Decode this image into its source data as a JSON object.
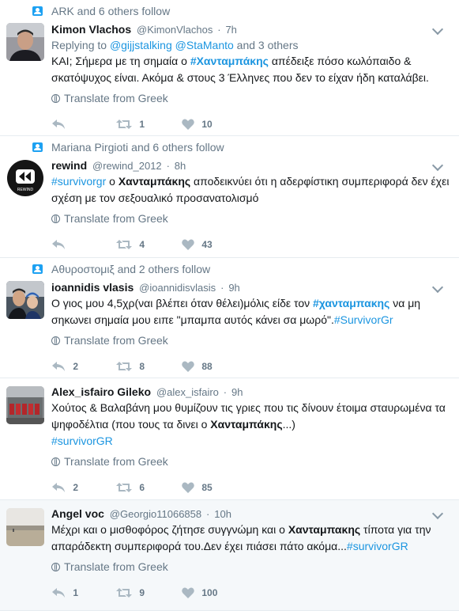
{
  "tweets": [
    {
      "social_context": "ARK and 6 others follow",
      "name": "Kimon Vlachos",
      "handle": "@KimonVlachos",
      "separator": "·",
      "time": "7h",
      "replying_prefix": "Replying to",
      "replying_user1": "@gijjstalking",
      "replying_user2": "@StaManto",
      "replying_suffix": "and 3 others",
      "text_1": "ΚΑΙ; Σήμερα με τη σημαία ο ",
      "hashtag_1": "#Χανταμπάκης",
      "text_2": " απέδειξε πόσο κωλόπαιδο & σκατόψυχος είναι. Ακόμα & στους 3 Έλληνες που δεν το είχαν ήδη καταλάβει.",
      "translate": "Translate from Greek",
      "reply_count": "",
      "retweet_count": "1",
      "like_count": "10"
    },
    {
      "social_context": "Mariana Pirgioti and 6 others follow",
      "name": "rewind",
      "handle": "@rewind_2012",
      "separator": "·",
      "time": "8h",
      "hashtag_1": "#survivorgr",
      "text_1": " ο ",
      "bold_1": "Χανταμπάκης",
      "text_2": " αποδεικνύει ότι η αδερφίστικη συμπεριφορά δεν έχει σχέση με τον σεξουαλικό προσανατολισμό",
      "translate": "Translate from Greek",
      "reply_count": "",
      "retweet_count": "4",
      "like_count": "43"
    },
    {
      "social_context": "Αθυροστομιξ and 2 others follow",
      "name": "ioannidis vlasis",
      "handle": "@ioannidisvlasis",
      "separator": "·",
      "time": "9h",
      "text_1": "Ο γιος μου 4,5χρ(ναι βλέπει όταν θέλει)μόλις είδε τον  ",
      "hashtag_1": "#χανταμπακης",
      "text_2": " να μη σηκωνει σημαία μου ειπε \"μπαμπα αυτός κάνει σα μωρό\".",
      "hashtag_2": "#SurvivorGr",
      "translate": "Translate from Greek",
      "reply_count": "2",
      "retweet_count": "8",
      "like_count": "88"
    },
    {
      "name": "Alex_isfairo Gileko",
      "handle": "@alex_isfairo",
      "separator": "·",
      "time": "9h",
      "text_1": "Χούτος & Βαλαβάνη μου θυμίζουν τις γριες που τις δίνουν έτοιμα σταυρωμένα τα ψηφοδέλτια (που τους τα δινει ο ",
      "bold_1": "Χανταμπάκης",
      "text_2": "...)",
      "hashtag_1": "#survivorGR",
      "translate": "Translate from Greek",
      "reply_count": "2",
      "retweet_count": "6",
      "like_count": "85"
    },
    {
      "name": "Angel voc",
      "handle": "@Georgio11066858",
      "separator": "·",
      "time": "10h",
      "text_1": "Μέχρι και ο μισθοφόρος ζήτησε συγγνώμη και ο ",
      "bold_1": "Χανταμπακης",
      "text_2": " τίποτα για την απαράδεκτη συμπεριφορά του.Δεν έχει πιάσει πάτο ακόμα...",
      "hashtag_1": "#survivorGR",
      "translate": "Translate from Greek",
      "reply_count": "1",
      "retweet_count": "9",
      "like_count": "100"
    }
  ],
  "colors": {
    "link": "#1b95e0",
    "muted": "#657786",
    "highlight_bg": "#f5f8fa"
  }
}
